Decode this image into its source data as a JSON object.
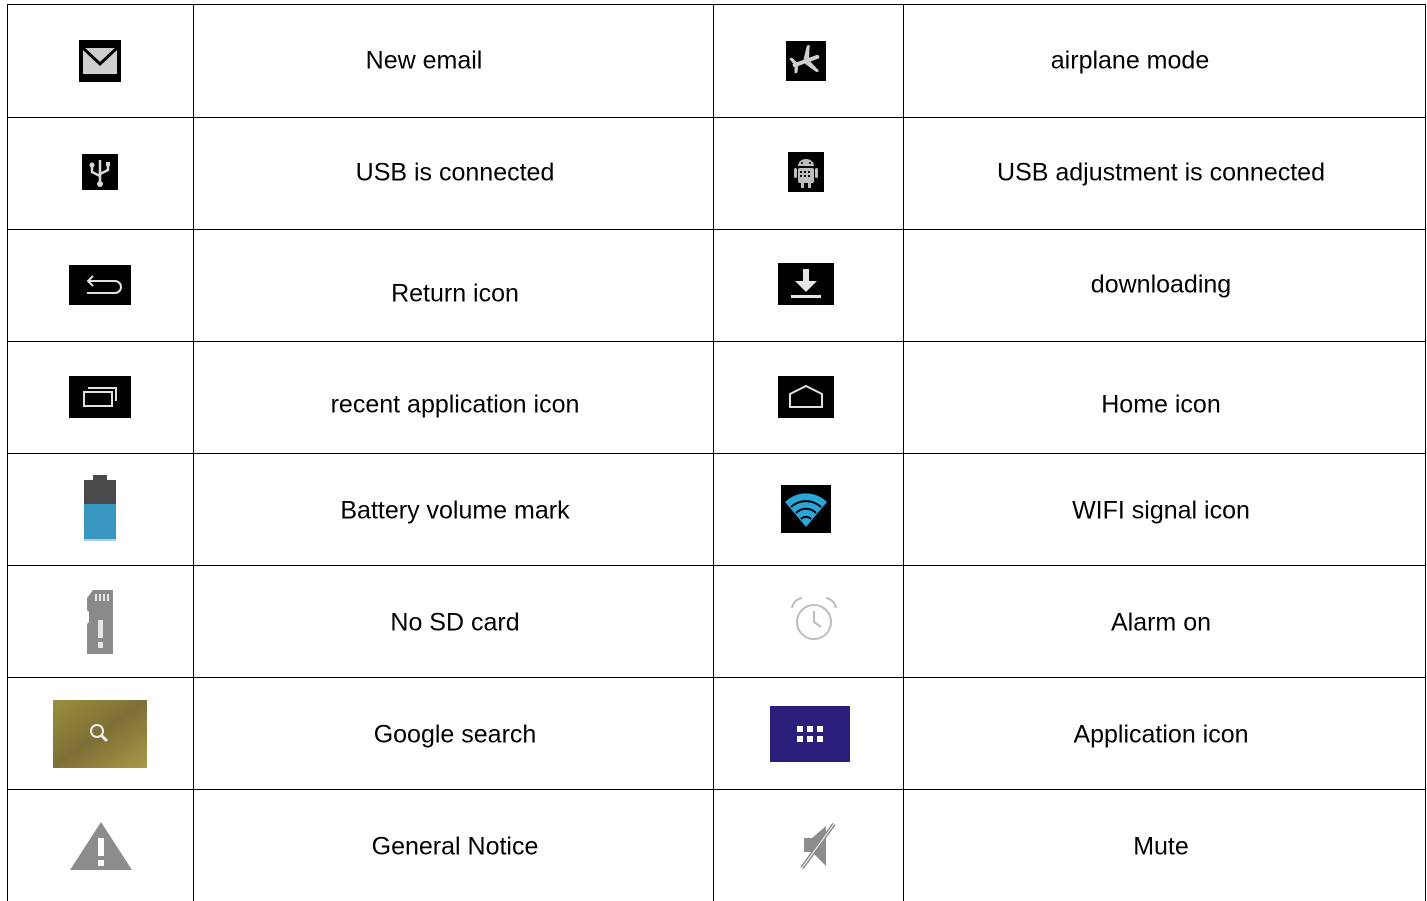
{
  "rows": [
    {
      "left": {
        "icon": "envelope-icon",
        "label": "New email"
      },
      "right": {
        "icon": "airplane-icon",
        "label": "airplane mode"
      }
    },
    {
      "left": {
        "icon": "usb-icon",
        "label": "USB is connected"
      },
      "right": {
        "icon": "android-debug-icon",
        "label": "USB adjustment is connected"
      }
    },
    {
      "left": {
        "icon": "back-arrow-icon",
        "label": "Return icon"
      },
      "right": {
        "icon": "download-icon",
        "label": "downloading"
      }
    },
    {
      "left": {
        "icon": "recent-apps-icon",
        "label": "recent application icon"
      },
      "right": {
        "icon": "home-icon",
        "label": "Home icon"
      }
    },
    {
      "left": {
        "icon": "battery-icon",
        "label": "Battery volume mark"
      },
      "right": {
        "icon": "wifi-icon",
        "label": "WIFI signal icon"
      }
    },
    {
      "left": {
        "icon": "sd-card-icon",
        "label": "No SD card"
      },
      "right": {
        "icon": "alarm-clock-icon",
        "label": "Alarm on"
      }
    },
    {
      "left": {
        "icon": "search-icon",
        "label": "Google search"
      },
      "right": {
        "icon": "app-grid-icon",
        "label": "Application icon"
      }
    },
    {
      "left": {
        "icon": "warning-icon",
        "label": "General Notice"
      },
      "right": {
        "icon": "mute-icon",
        "label": "Mute"
      }
    }
  ],
  "colors": {
    "border": "#000000",
    "icon_dark_bg": "#000000",
    "battery_fill": "#3a97c2",
    "wifi_blue": "#2aa6d8",
    "grey_icon": "#8c8c8c",
    "app_grid_bg": "#2a1f7a",
    "search_bg": "#8a7f3c"
  }
}
